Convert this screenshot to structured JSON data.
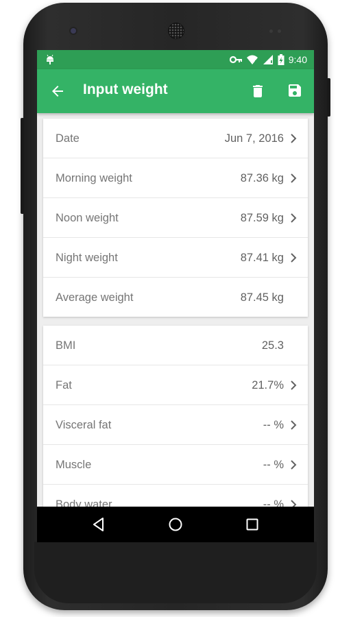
{
  "status_bar": {
    "time": "9:40"
  },
  "toolbar": {
    "title": "Input weight"
  },
  "weight_card": {
    "rows": [
      {
        "label": "Date",
        "value": "Jun 7, 2016"
      },
      {
        "label": "Morning weight",
        "value": "87.36 kg"
      },
      {
        "label": "Noon weight",
        "value": "87.59 kg"
      },
      {
        "label": "Night weight",
        "value": "87.41 kg"
      },
      {
        "label": "Average weight",
        "value": "87.45 kg"
      }
    ]
  },
  "body_card": {
    "rows": [
      {
        "label": "BMI",
        "value": "25.3"
      },
      {
        "label": "Fat",
        "value": "21.7%"
      },
      {
        "label": "Visceral fat",
        "value": "-- %"
      },
      {
        "label": "Muscle",
        "value": "-- %"
      },
      {
        "label": "Body water",
        "value": "-- %"
      }
    ]
  },
  "colors": {
    "toolbar": "#34b366",
    "status_bar": "#2e9e55",
    "background": "#eeeeee",
    "label_text": "#757575",
    "value_text": "#616161"
  }
}
